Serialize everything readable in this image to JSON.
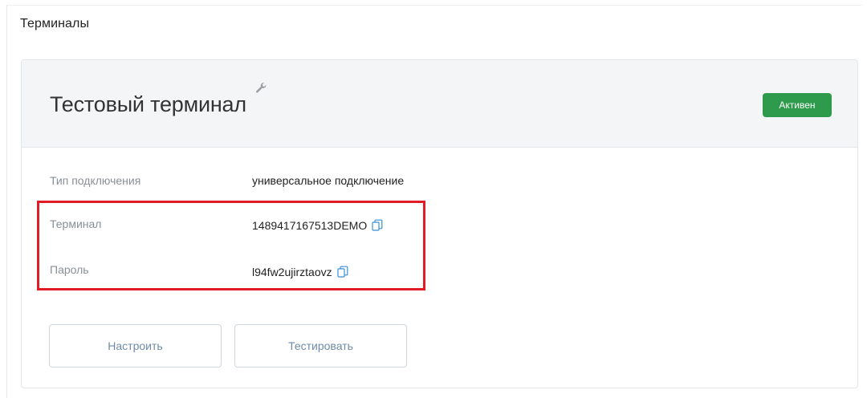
{
  "page": {
    "title": "Терминалы"
  },
  "terminal": {
    "name": "Тестовый терминал",
    "status": "Активен",
    "rows": [
      {
        "label": "Тип подключения",
        "value": "универсальное подключение"
      },
      {
        "label": "Терминал",
        "value": "1489417167513DEMO"
      },
      {
        "label": "Пароль",
        "value": "l94fw2ujirztaovz"
      }
    ],
    "buttons": {
      "configure": "Настроить",
      "test": "Тестировать"
    }
  },
  "icons": {
    "settings": "wrench-icon",
    "copy": "copy-icon"
  },
  "colors": {
    "status_active": "#2e9b4c",
    "highlight": "#e21c26",
    "button_text": "#6f8ba6",
    "copy_icon": "#3a8fd8"
  }
}
